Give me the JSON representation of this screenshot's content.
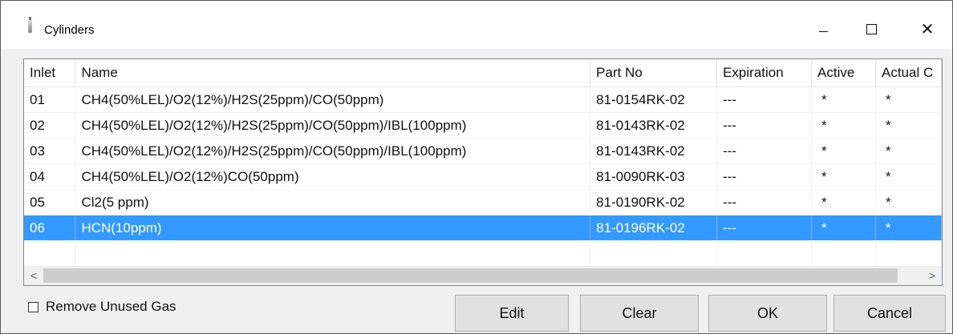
{
  "window": {
    "title": "Cylinders",
    "controls": {
      "minimize": "—",
      "maximize": "☐",
      "close": "✕"
    }
  },
  "table": {
    "columns": [
      "Inlet",
      "Name",
      "Part No",
      "Expiration",
      "Active",
      "Actual C"
    ],
    "rows": [
      {
        "inlet": "01",
        "name": "CH4(50%LEL)/O2(12%)/H2S(25ppm)/CO(50ppm)",
        "part_no": "81-0154RK-02",
        "expiration": "---",
        "active": "*",
        "actual": "*"
      },
      {
        "inlet": "02",
        "name": "CH4(50%LEL)/O2(12%)/H2S(25ppm)/CO(50ppm)/IBL(100ppm)",
        "part_no": "81-0143RK-02",
        "expiration": "---",
        "active": "*",
        "actual": "*"
      },
      {
        "inlet": "03",
        "name": "CH4(50%LEL)/O2(12%)/H2S(25ppm)/CO(50ppm)/IBL(100ppm)",
        "part_no": "81-0143RK-02",
        "expiration": "---",
        "active": "*",
        "actual": "*"
      },
      {
        "inlet": "04",
        "name": "CH4(50%LEL)/O2(12%)CO(50ppm)",
        "part_no": "81-0090RK-03",
        "expiration": "---",
        "active": "*",
        "actual": "*"
      },
      {
        "inlet": "05",
        "name": "Cl2(5 ppm)",
        "part_no": "81-0190RK-02",
        "expiration": "---",
        "active": "*",
        "actual": "*"
      },
      {
        "inlet": "06",
        "name": "HCN(10ppm)",
        "part_no": "81-0196RK-02",
        "expiration": "---",
        "active": "*",
        "actual": "*",
        "selected": true
      }
    ],
    "scroll": {
      "left_arrow": "<",
      "right_arrow": ">"
    }
  },
  "options": {
    "remove_unused_gas_label": "Remove Unused Gas",
    "remove_unused_gas_checked": false
  },
  "buttons": {
    "edit": "Edit",
    "clear": "Clear",
    "ok": "OK",
    "cancel": "Cancel"
  },
  "colors": {
    "selection": "#3399ff",
    "button_face": "#e1e1e1",
    "dialog_background": "#f0f0f0"
  }
}
